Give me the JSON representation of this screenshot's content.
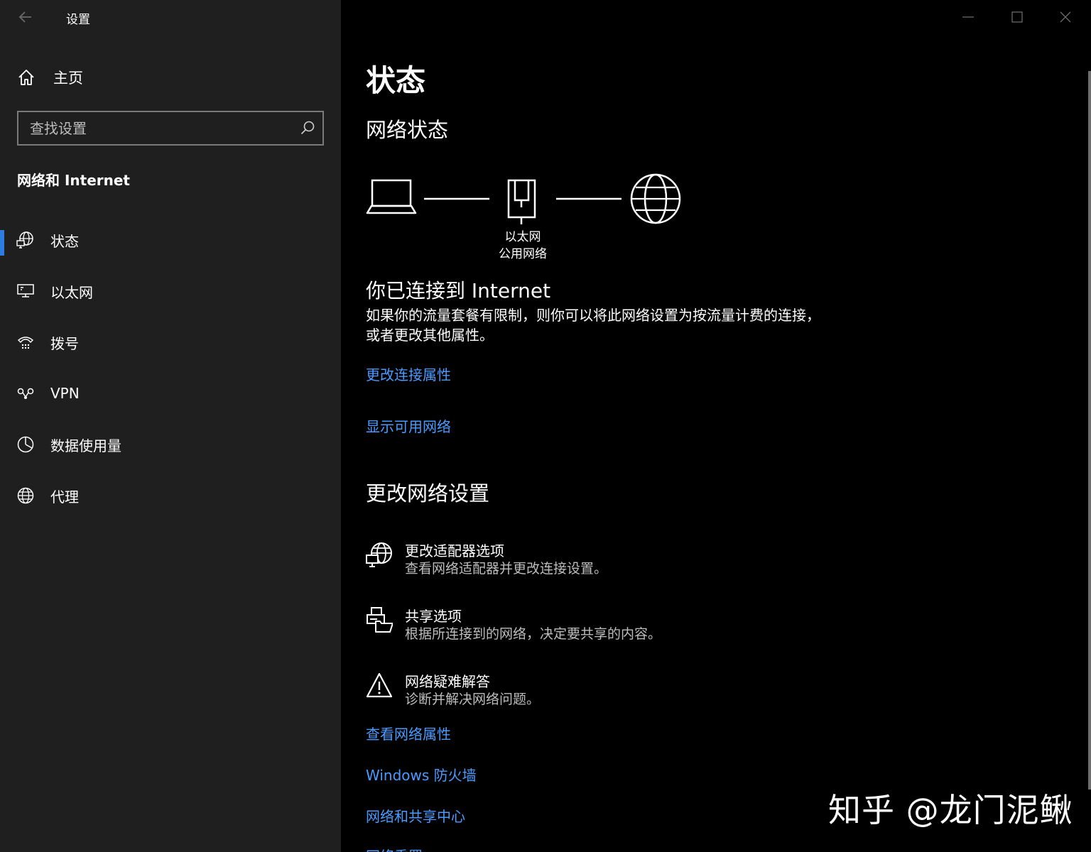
{
  "window": {
    "title": "设置"
  },
  "sidebar": {
    "home_label": "主页",
    "search": {
      "placeholder": "查找设置"
    },
    "section_title": "网络和 Internet",
    "items": [
      {
        "label": "状态",
        "icon": "network-status-icon",
        "active": true
      },
      {
        "label": "以太网",
        "icon": "ethernet-icon"
      },
      {
        "label": "拨号",
        "icon": "dialup-icon"
      },
      {
        "label": "VPN",
        "icon": "vpn-icon"
      },
      {
        "label": "数据使用量",
        "icon": "data-usage-icon"
      },
      {
        "label": "代理",
        "icon": "globe-icon"
      }
    ]
  },
  "main": {
    "page_title": "状态",
    "network_status_heading": "网络状态",
    "diagram": {
      "adapter_name": "以太网",
      "network_type": "公用网络"
    },
    "connected_title": "你已连接到 Internet",
    "connected_desc": "如果你的流量套餐有限制，则你可以将此网络设置为按流量计费的连接，或者更改其他属性。",
    "link_change_props": "更改连接属性",
    "link_show_networks": "显示可用网络",
    "change_settings_heading": "更改网络设置",
    "settings": [
      {
        "title": "更改适配器选项",
        "desc": "查看网络适配器并更改连接设置。",
        "icon": "adapter-icon"
      },
      {
        "title": "共享选项",
        "desc": "根据所连接到的网络，决定要共享的内容。",
        "icon": "sharing-icon"
      },
      {
        "title": "网络疑难解答",
        "desc": "诊断并解决网络问题。",
        "icon": "warning-icon"
      }
    ],
    "link_view_props": "查看网络属性",
    "link_firewall": "Windows 防火墙",
    "link_sharing_center": "网络和共享中心",
    "link_reset": "网络重置"
  },
  "watermark": "知乎 @龙门泥鳅",
  "colors": {
    "sidebar_bg": "#1f1f1f",
    "main_bg": "#000000",
    "accent": "#2d7de0",
    "link": "#4a9bff"
  }
}
